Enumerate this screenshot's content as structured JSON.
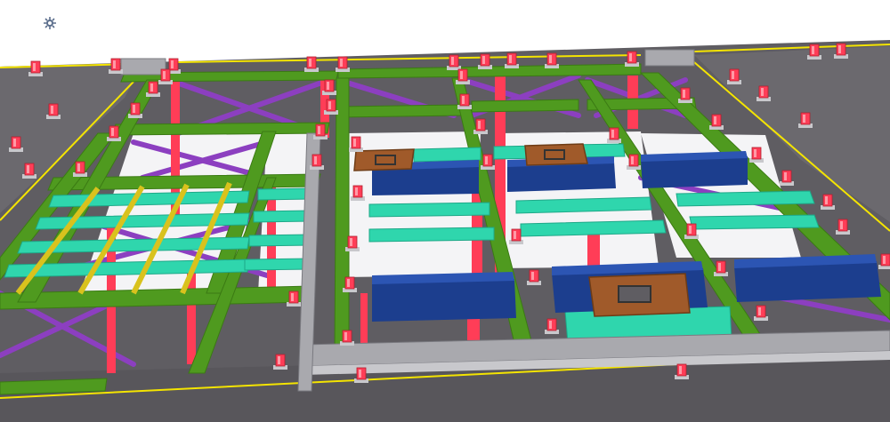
{
  "viewer": {
    "background": "#ffffff",
    "colors": {
      "slab": "#5f5d62",
      "slab_light": "#8a888d",
      "edge_line": "#f4e400",
      "girder_green": "#4f9a1f",
      "girder_green_dark": "#3b7a14",
      "beam_cyan": "#2fd6ad",
      "beam_cyan_dark": "#1ea888",
      "beam_yellow": "#d9c21d",
      "brace_purple": "#8c3fc0",
      "column_red": "#ff3d57",
      "column_red_light": "#ff7a8a",
      "box_blue": "#1c3e8e",
      "box_blue_light": "#2c55b3",
      "plate_brown": "#a05a2a",
      "concrete_grey": "#c8c8cc",
      "steel_grey": "#a9a9ae"
    }
  },
  "toolbar": {
    "icon": "settings-gear-icon"
  }
}
